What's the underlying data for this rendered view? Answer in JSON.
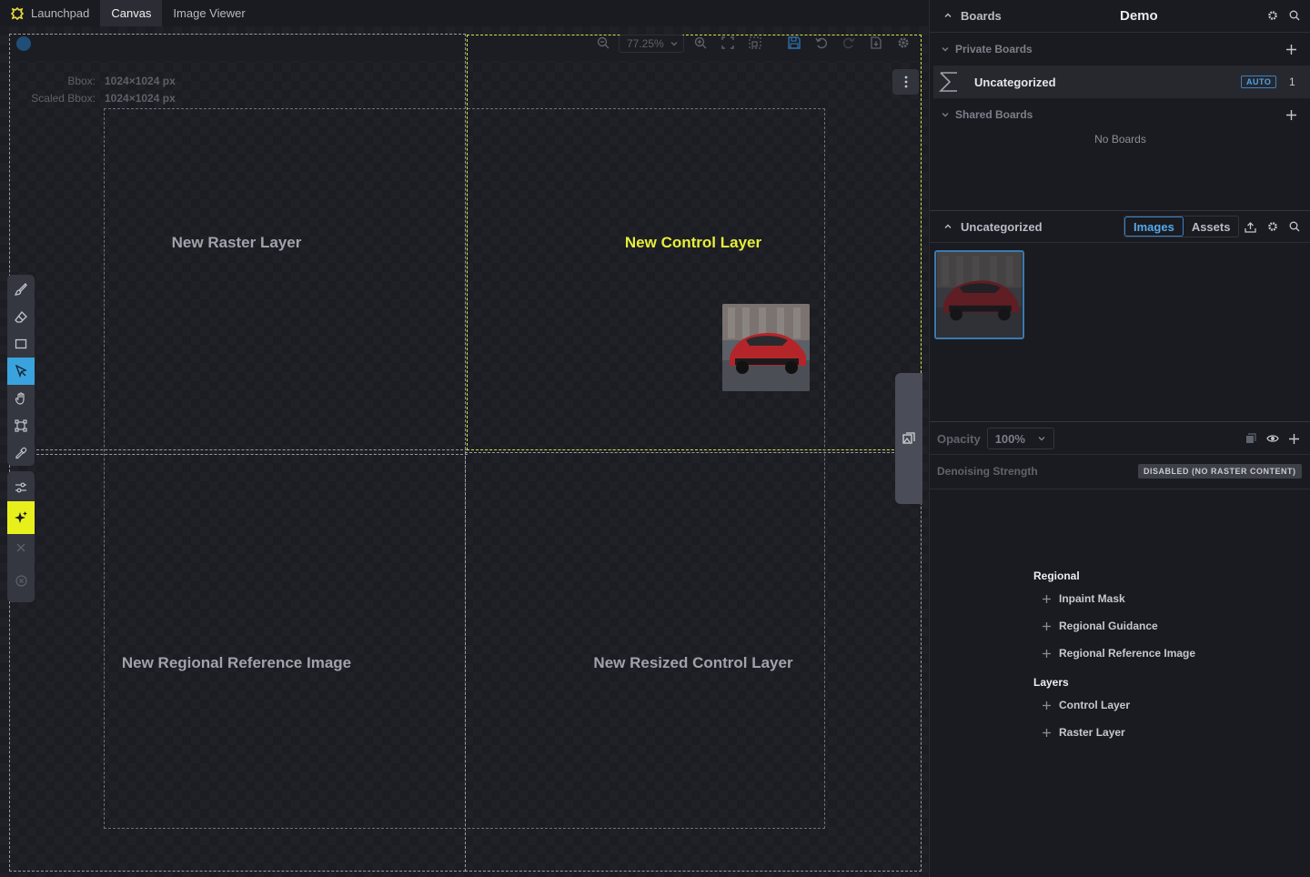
{
  "tabs": [
    {
      "label": "Launchpad",
      "icon": "sparkles-logo-icon"
    },
    {
      "label": "Canvas",
      "active": true
    },
    {
      "label": "Image Viewer"
    }
  ],
  "canvas": {
    "zoom": "77.25%",
    "bbox_label": "Bbox:",
    "bbox_value": "1024×1024 px",
    "scaled_bbox_label": "Scaled Bbox:",
    "scaled_bbox_value": "1024×1024 px",
    "quadrants": {
      "top_left": "New Raster Layer",
      "top_right": "New Control Layer",
      "bottom_left": "New Regional Reference Image",
      "bottom_right": "New Resized Control Layer"
    },
    "highlight_color": "#e6ee3a",
    "active_tool_color": "#3aa3dd"
  },
  "boards": {
    "header": "Boards",
    "current": "Demo",
    "private_label": "Private Boards",
    "uncategorized_label": "Uncategorized",
    "auto_badge": "AUTO",
    "uncategorized_count": "1",
    "shared_label": "Shared Boards",
    "no_boards": "No Boards"
  },
  "gallery": {
    "board_name": "Uncategorized",
    "tab_images": "Images",
    "tab_assets": "Assets"
  },
  "layer_settings": {
    "opacity_label": "Opacity",
    "opacity_value": "100%",
    "denoise_label": "Denoising Strength",
    "denoise_badge": "DISABLED (NO RASTER CONTENT)"
  },
  "add_menu": {
    "regional_title": "Regional",
    "regional_items": [
      "Inpaint Mask",
      "Regional Guidance",
      "Regional Reference Image"
    ],
    "layers_title": "Layers",
    "layers_items": [
      "Control Layer",
      "Raster Layer"
    ]
  }
}
